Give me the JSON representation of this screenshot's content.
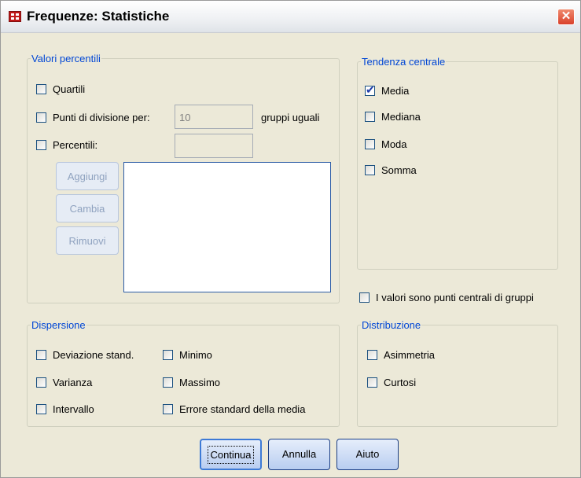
{
  "window": {
    "title": "Frequenze: Statistiche",
    "close_label": "✕"
  },
  "percentiles": {
    "legend": "Valori percentili",
    "quartiles": {
      "label": "Quartili",
      "checked": false
    },
    "cut_points": {
      "label": "Punti di divisione per:",
      "value": "10",
      "suffix": "gruppi uguali",
      "checked": false
    },
    "percentiles": {
      "label": "Percentili:",
      "value": "",
      "checked": false
    },
    "buttons": {
      "add": "Aggiungi",
      "change": "Cambia",
      "remove": "Rimuovi"
    }
  },
  "central_tendency": {
    "legend": "Tendenza centrale",
    "items": [
      {
        "label": "Media",
        "checked": true
      },
      {
        "label": "Mediana",
        "checked": false
      },
      {
        "label": "Moda",
        "checked": false
      },
      {
        "label": "Somma",
        "checked": false
      }
    ]
  },
  "group_midpoints": {
    "label": "I valori sono punti centrali di gruppi",
    "checked": false
  },
  "dispersion": {
    "legend": "Dispersione",
    "items": [
      {
        "label": "Deviazione stand.",
        "checked": false
      },
      {
        "label": "Minimo",
        "checked": false
      },
      {
        "label": "Varianza",
        "checked": false
      },
      {
        "label": "Massimo",
        "checked": false
      },
      {
        "label": "Intervallo",
        "checked": false
      },
      {
        "label": "Errore standard della media",
        "checked": false
      }
    ]
  },
  "distribution": {
    "legend": "Distribuzione",
    "items": [
      {
        "label": "Asimmetria",
        "checked": false
      },
      {
        "label": "Curtosi",
        "checked": false
      }
    ]
  },
  "footer": {
    "continue": "Continua",
    "cancel": "Annulla",
    "help": "Aiuto"
  }
}
